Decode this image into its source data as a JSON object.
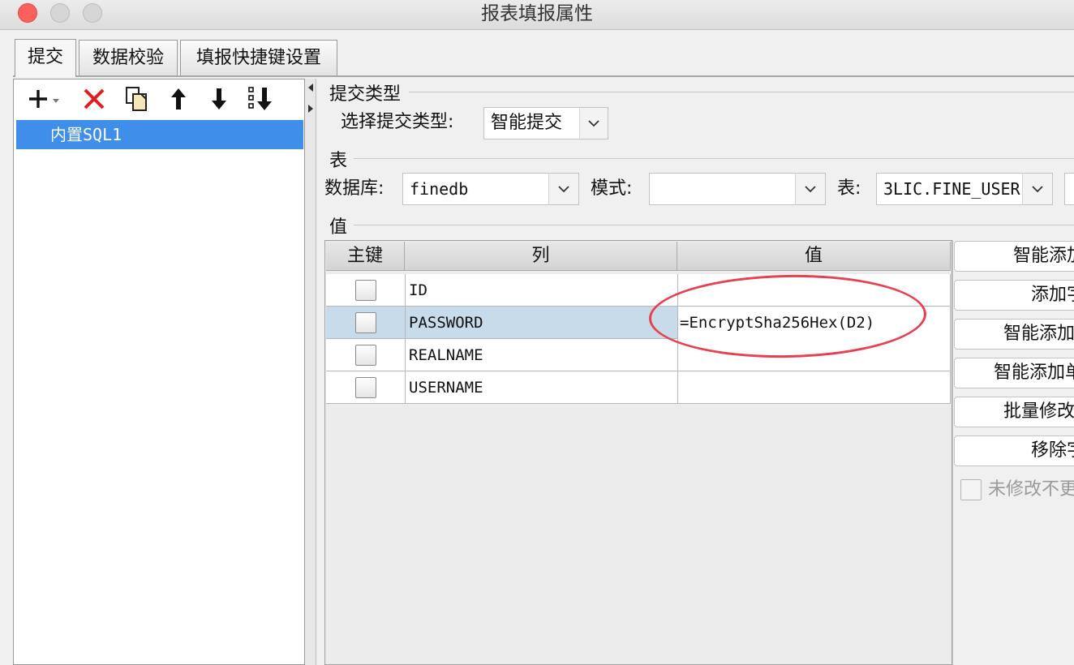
{
  "window": {
    "title": "报表填报属性"
  },
  "tabs": [
    {
      "label": "提交",
      "active": true
    },
    {
      "label": "数据校验",
      "active": false
    },
    {
      "label": "填报快捷键设置",
      "active": false
    }
  ],
  "toolbar": {
    "icons": [
      "add-icon",
      "delete-icon",
      "copy-icon",
      "arrow-up-icon",
      "arrow-down-icon",
      "move-to-bottom-icon"
    ]
  },
  "submit_list": {
    "items": [
      {
        "label": "内置SQL1",
        "selected": true
      }
    ]
  },
  "submit_type": {
    "section_label": "提交类型",
    "select_label": "选择提交类型:",
    "value": "智能提交"
  },
  "table_section": {
    "section_label": "表",
    "database_label": "数据库:",
    "database_value": "finedb",
    "schema_label": "模式:",
    "schema_value": "",
    "table_label": "表:",
    "table_value": "3LIC.FINE_USER"
  },
  "value_section": {
    "section_label": "值",
    "headers": {
      "primary_key": "主键",
      "column": "列",
      "value": "值"
    },
    "rows": [
      {
        "primary_key": false,
        "column": "ID",
        "value": ""
      },
      {
        "primary_key": false,
        "column": "PASSWORD",
        "value": "=EncryptSha256Hex(D2)"
      },
      {
        "primary_key": false,
        "column": "REALNAME",
        "value": ""
      },
      {
        "primary_key": false,
        "column": "USERNAME",
        "value": ""
      }
    ],
    "selected_row": 1
  },
  "side_buttons": {
    "b1": "智能添加",
    "b2": "添加字",
    "b3": "智能添加",
    "b4": "智能添加单",
    "b5": "批量修改",
    "b6": "移除字",
    "unchanged_checkbox": "未修改不更"
  },
  "colors": {
    "selection_blue": "#3f8fea",
    "row_selected": "#c8dbea",
    "annotation_red": "#e8404e",
    "close_red": "#fc605c"
  }
}
